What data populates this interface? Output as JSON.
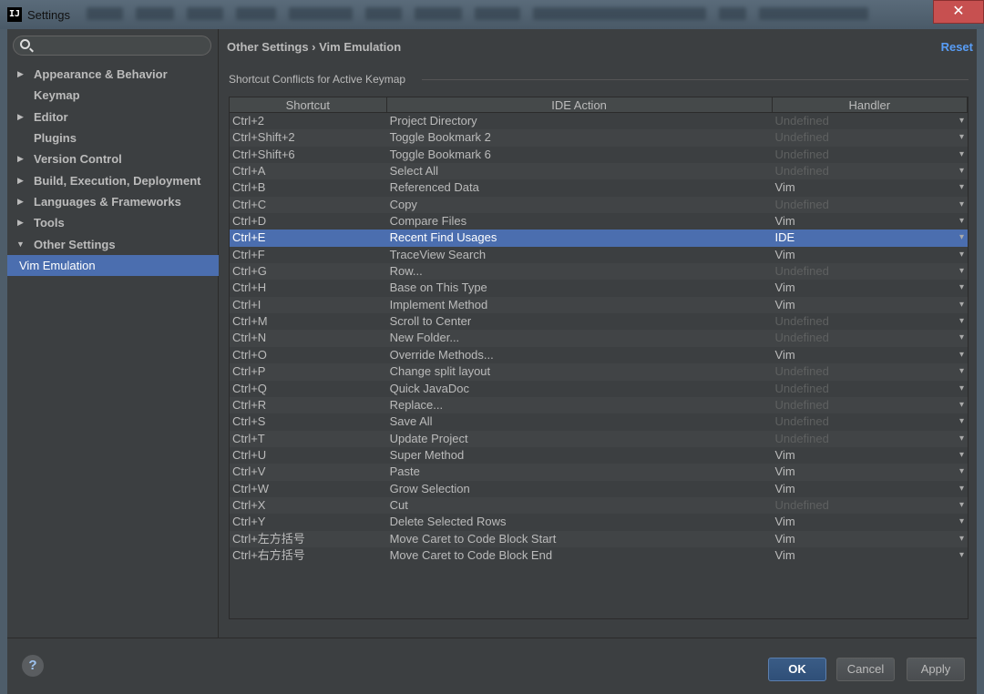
{
  "window": {
    "title": "Settings",
    "app_icon": "IJ",
    "close_glyph": "✕"
  },
  "search": {
    "value": "",
    "placeholder": ""
  },
  "sidebar": {
    "items": [
      {
        "label": "Appearance & Behavior",
        "expandable": true
      },
      {
        "label": "Keymap",
        "expandable": false
      },
      {
        "label": "Editor",
        "expandable": true
      },
      {
        "label": "Plugins",
        "expandable": false
      },
      {
        "label": "Version Control",
        "expandable": true
      },
      {
        "label": "Build, Execution, Deployment",
        "expandable": true
      },
      {
        "label": "Languages & Frameworks",
        "expandable": true
      },
      {
        "label": "Tools",
        "expandable": true
      },
      {
        "label": "Other Settings",
        "expandable": true,
        "expanded": true
      },
      {
        "label": "Vim Emulation",
        "child": true,
        "selected": true
      }
    ]
  },
  "header": {
    "breadcrumb": "Other Settings › Vim Emulation",
    "reset_label": "Reset"
  },
  "group": {
    "title": "Shortcut Conflicts for Active Keymap"
  },
  "table": {
    "columns": [
      "Shortcut",
      "IDE Action",
      "Handler"
    ],
    "rows": [
      {
        "shortcut": "Ctrl+2",
        "action": "Project Directory",
        "handler": "Undefined"
      },
      {
        "shortcut": "Ctrl+Shift+2",
        "action": "Toggle Bookmark 2",
        "handler": "Undefined"
      },
      {
        "shortcut": "Ctrl+Shift+6",
        "action": "Toggle Bookmark 6",
        "handler": "Undefined"
      },
      {
        "shortcut": "Ctrl+A",
        "action": "Select All",
        "handler": "Undefined"
      },
      {
        "shortcut": "Ctrl+B",
        "action": "Referenced Data",
        "handler": "Vim"
      },
      {
        "shortcut": "Ctrl+C",
        "action": "Copy",
        "handler": "Undefined"
      },
      {
        "shortcut": "Ctrl+D",
        "action": "Compare Files",
        "handler": "Vim"
      },
      {
        "shortcut": "Ctrl+E",
        "action": "Recent Find Usages",
        "handler": "IDE",
        "selected": true
      },
      {
        "shortcut": "Ctrl+F",
        "action": "TraceView Search",
        "handler": "Vim"
      },
      {
        "shortcut": "Ctrl+G",
        "action": "Row...",
        "handler": "Undefined"
      },
      {
        "shortcut": "Ctrl+H",
        "action": "Base on This Type",
        "handler": "Vim"
      },
      {
        "shortcut": "Ctrl+I",
        "action": "Implement Method",
        "handler": "Vim"
      },
      {
        "shortcut": "Ctrl+M",
        "action": "Scroll to Center",
        "handler": "Undefined"
      },
      {
        "shortcut": "Ctrl+N",
        "action": "New Folder...",
        "handler": "Undefined"
      },
      {
        "shortcut": "Ctrl+O",
        "action": "Override Methods...",
        "handler": "Vim"
      },
      {
        "shortcut": "Ctrl+P",
        "action": "Change split layout",
        "handler": "Undefined"
      },
      {
        "shortcut": "Ctrl+Q",
        "action": "Quick JavaDoc",
        "handler": "Undefined"
      },
      {
        "shortcut": "Ctrl+R",
        "action": "Replace...",
        "handler": "Undefined"
      },
      {
        "shortcut": "Ctrl+S",
        "action": "Save All",
        "handler": "Undefined"
      },
      {
        "shortcut": "Ctrl+T",
        "action": "Update Project",
        "handler": "Undefined"
      },
      {
        "shortcut": "Ctrl+U",
        "action": "Super Method",
        "handler": "Vim"
      },
      {
        "shortcut": "Ctrl+V",
        "action": "Paste",
        "handler": "Vim"
      },
      {
        "shortcut": "Ctrl+W",
        "action": "Grow Selection",
        "handler": "Vim"
      },
      {
        "shortcut": "Ctrl+X",
        "action": "Cut",
        "handler": "Undefined"
      },
      {
        "shortcut": "Ctrl+Y",
        "action": "Delete Selected Rows",
        "handler": "Vim"
      },
      {
        "shortcut": "Ctrl+左方括号",
        "action": "Move Caret to Code Block Start",
        "handler": "Vim"
      },
      {
        "shortcut": "Ctrl+右方括号",
        "action": "Move Caret to Code Block End",
        "handler": "Vim"
      }
    ]
  },
  "footer": {
    "help_label": "?",
    "ok_label": "OK",
    "cancel_label": "Cancel",
    "apply_label": "Apply"
  },
  "colors": {
    "accent": "#4b6eaf",
    "link": "#589df6",
    "background": "#3c3f41"
  }
}
